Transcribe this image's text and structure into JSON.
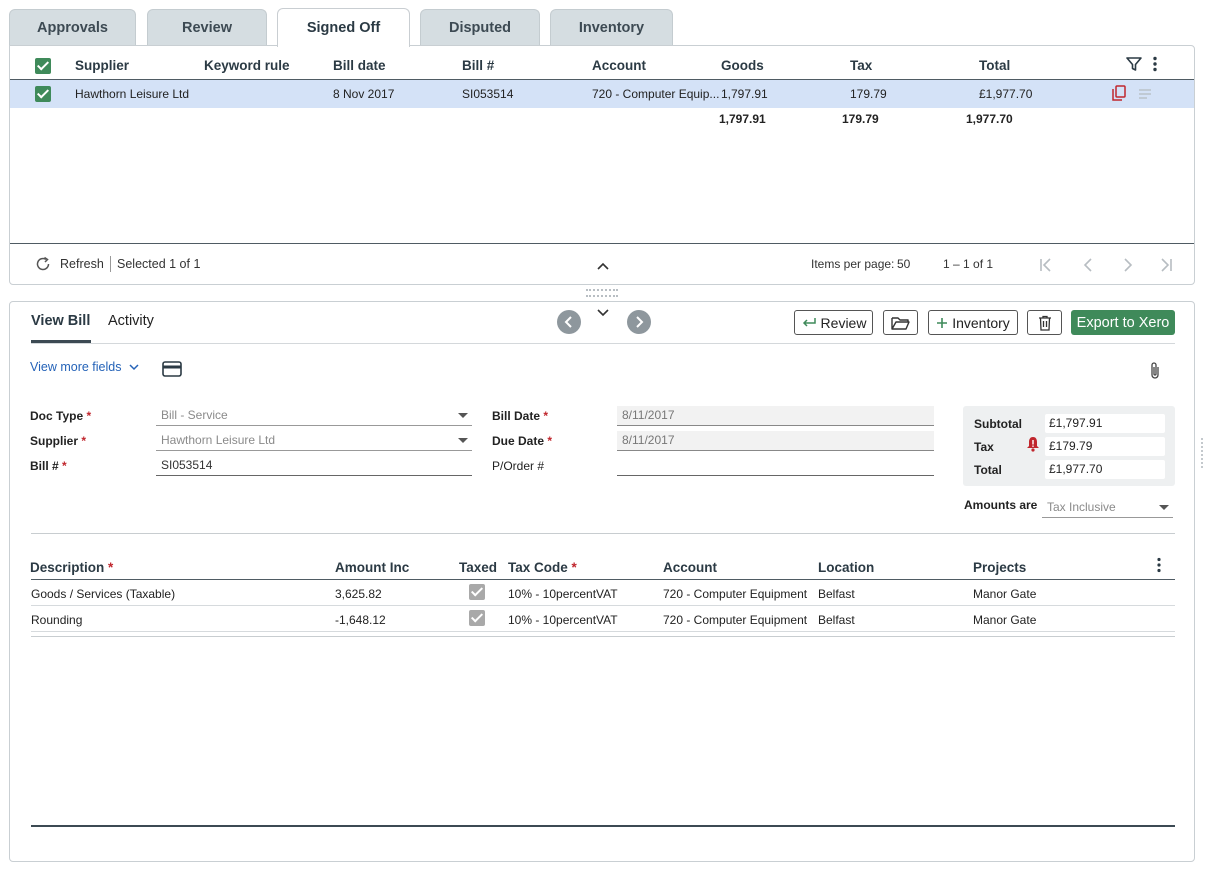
{
  "tabs": [
    "Approvals",
    "Review",
    "Signed Off",
    "Disputed",
    "Inventory"
  ],
  "active_tab": "Signed Off",
  "grid": {
    "columns": [
      "Supplier",
      "Keyword rule",
      "Bill date",
      "Bill #",
      "Account",
      "Goods",
      "Tax",
      "Total"
    ],
    "rows": [
      {
        "supplier": "Hawthorn Leisure Ltd",
        "keyword_rule": "",
        "bill_date": "8 Nov 2017",
        "bill_no": "SI053514",
        "account": "720 - Computer Equip...",
        "goods": "1,797.91",
        "tax": "179.79",
        "total": "£1,977.70",
        "selected": true
      }
    ],
    "totals": {
      "goods": "1,797.91",
      "tax": "179.79",
      "total": "1,977.70"
    },
    "footer": {
      "refresh": "Refresh",
      "selected": "Selected 1 of 1",
      "items_per_page_label": "Items per page:",
      "items_per_page": "50",
      "range": "1 – 1 of 1"
    }
  },
  "bill": {
    "tabs": [
      "View Bill",
      "Activity"
    ],
    "active_tab": "View Bill",
    "buttons": {
      "review": "Review",
      "inventory": "Inventory",
      "export": "Export to Xero"
    },
    "view_more_fields": "View more fields",
    "fields": {
      "doc_type": {
        "label": "Doc Type",
        "value": "Bill - Service"
      },
      "supplier": {
        "label": "Supplier",
        "value": "Hawthorn Leisure Ltd"
      },
      "bill_no": {
        "label": "Bill #",
        "value": "SI053514"
      },
      "bill_date": {
        "label": "Bill Date",
        "value": "8/11/2017"
      },
      "due_date": {
        "label": "Due Date",
        "value": "8/11/2017"
      },
      "po_no": {
        "label": "P/Order #",
        "value": ""
      }
    },
    "totals": {
      "subtotal_label": "Subtotal",
      "subtotal": "£1,797.91",
      "tax_label": "Tax",
      "tax": "£179.79",
      "total_label": "Total",
      "total": "£1,977.70"
    },
    "amounts_are": {
      "label": "Amounts are",
      "value": "Tax Inclusive"
    },
    "lines": {
      "columns": [
        "Description",
        "Amount Inc",
        "Taxed",
        "Tax Code",
        "Account",
        "Location",
        "Projects"
      ],
      "rows": [
        {
          "description": "Goods / Services (Taxable)",
          "amount": "3,625.82",
          "taxed": true,
          "tax_code": "10% - 10percentVAT",
          "account": "720 - Computer Equipment",
          "location": "Belfast",
          "project": "Manor Gate"
        },
        {
          "description": "Rounding",
          "amount": "-1,648.12",
          "taxed": true,
          "tax_code": "10% - 10percentVAT",
          "account": "720 - Computer Equipment",
          "location": "Belfast",
          "project": "Manor Gate"
        }
      ]
    }
  },
  "colors": {
    "accent_green": "#3f8a5a",
    "selected_row": "#d4e2f7",
    "required": "#c0262d",
    "link": "#2563b8"
  }
}
